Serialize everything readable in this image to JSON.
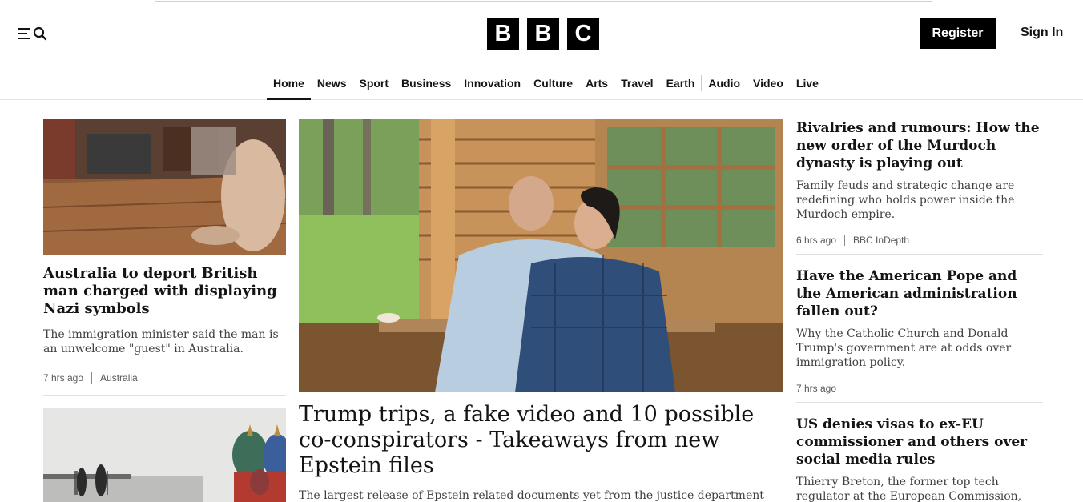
{
  "header": {
    "logo_letters": [
      "B",
      "B",
      "C"
    ],
    "register_label": "Register",
    "signin_label": "Sign In"
  },
  "nav": {
    "items": [
      {
        "label": "Home",
        "active": true
      },
      {
        "label": "News"
      },
      {
        "label": "Sport"
      },
      {
        "label": "Business"
      },
      {
        "label": "Innovation"
      },
      {
        "label": "Culture"
      },
      {
        "label": "Arts"
      },
      {
        "label": "Travel"
      },
      {
        "label": "Earth"
      },
      {
        "label": "Audio"
      },
      {
        "label": "Video"
      },
      {
        "label": "Live"
      }
    ]
  },
  "left": {
    "story1": {
      "title": "Australia to deport British man charged with displaying Nazi symbols",
      "desc": "The immigration minister said the man is an unwelcome \"guest\" in Australia.",
      "time": "7 hrs ago",
      "tag": "Australia"
    }
  },
  "center": {
    "headline": "Trump trips, a fake video and 10 possible co-conspirators - Takeaways from new Epstein files",
    "desc": "The largest release of Epstein-related documents yet from the justice department"
  },
  "right": {
    "story1": {
      "title": "Rivalries and rumours: How the new order of the Murdoch dynasty is playing out",
      "desc": "Family feuds and strategic change are redefining who holds power inside the Murdoch empire.",
      "time": "6 hrs ago",
      "tag": "BBC InDepth"
    },
    "story2": {
      "title": "Have the American Pope and the American administration fallen out?",
      "desc": "Why the Catholic Church and Donald Trump's government are at odds over immigration policy.",
      "time": "7 hrs ago"
    },
    "story3": {
      "title": "US denies visas to ex-EU commissioner and others over social media rules",
      "desc": "Thierry Breton, the former top tech regulator at the European Commission, says a \"witch"
    }
  },
  "colors": {
    "brand": "#000000",
    "text": "#141414",
    "muted": "#545658",
    "rule": "#e0e0e0"
  }
}
